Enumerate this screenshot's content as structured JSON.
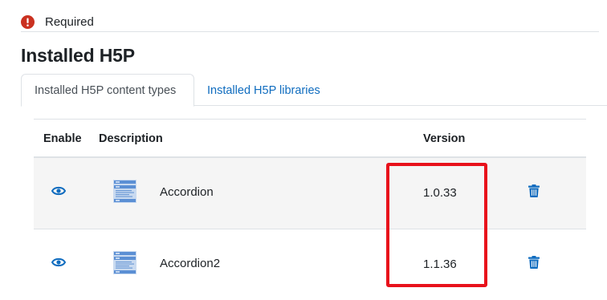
{
  "required": {
    "label": "Required",
    "icon": "exclamation-circle-icon",
    "color": "#ca3120"
  },
  "page": {
    "title": "Installed H5P"
  },
  "tabs": [
    {
      "label": "Installed H5P content types",
      "active": true
    },
    {
      "label": "Installed H5P libraries",
      "active": false
    }
  ],
  "table": {
    "headers": {
      "enable": "Enable",
      "description": "Description",
      "version": "Version"
    },
    "rows": [
      {
        "description": "Accordion",
        "version": "1.0.33",
        "enable_icon": "eye-icon",
        "delete_icon": "trash-icon",
        "thumbnail_icon": "accordion-thumbnail-icon"
      },
      {
        "description": "Accordion2",
        "version": "1.1.36",
        "enable_icon": "eye-icon",
        "delete_icon": "trash-icon",
        "thumbnail_icon": "accordion-thumbnail-icon"
      }
    ]
  },
  "colors": {
    "link": "#0f6cbf",
    "highlight": "#e8111b",
    "stripe": "#f5f5f5"
  }
}
